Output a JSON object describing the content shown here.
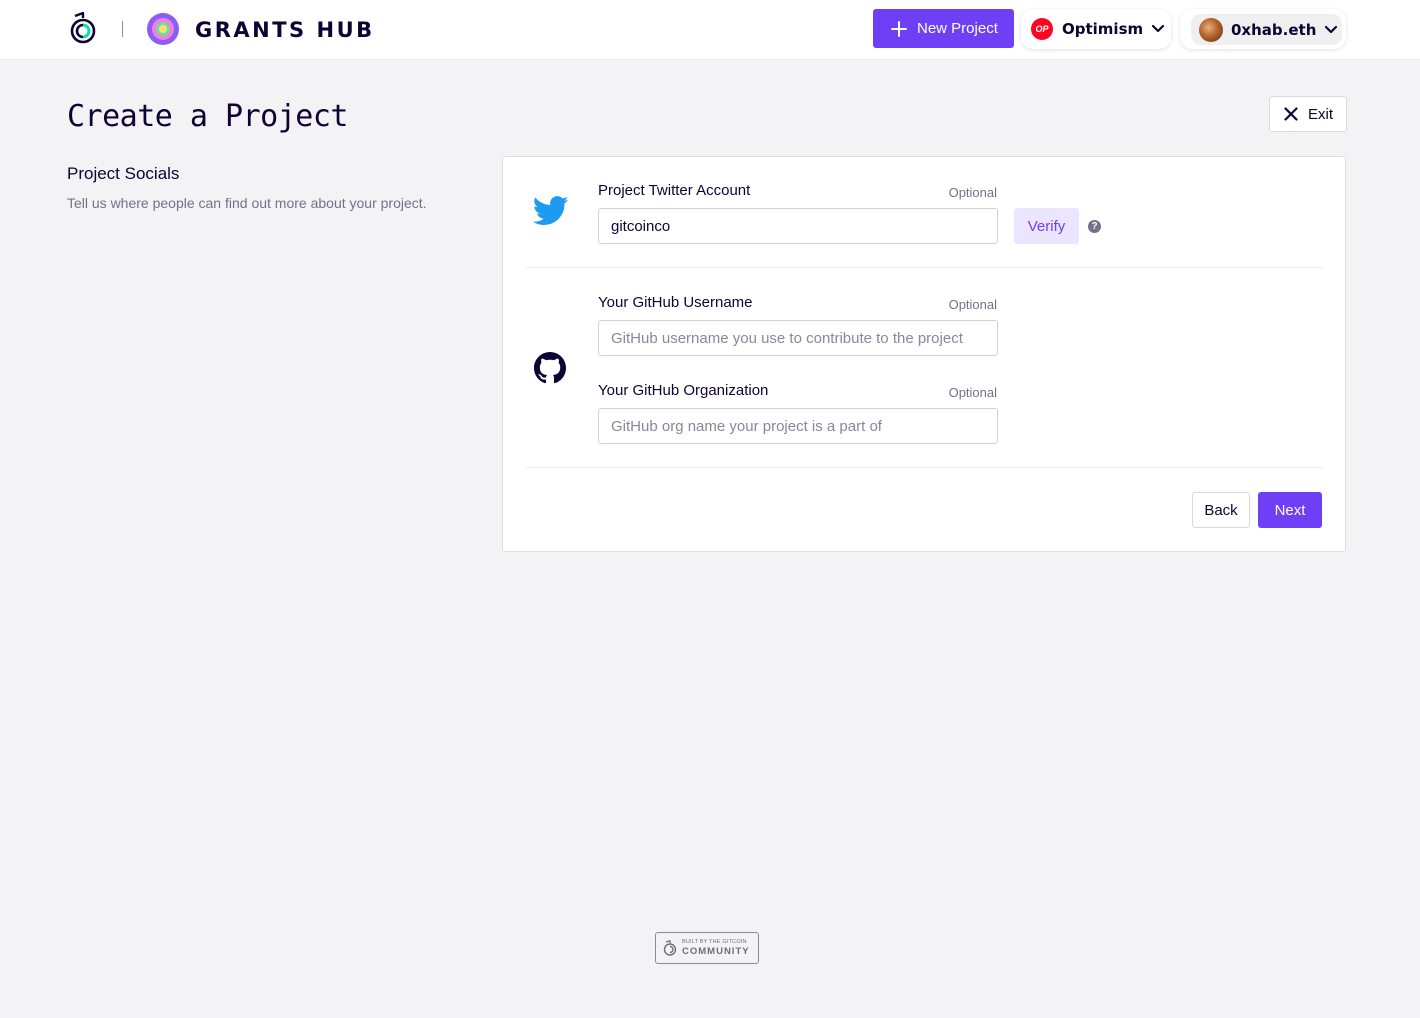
{
  "header": {
    "brand": "GRANTS HUB",
    "new_project_label": "New Project",
    "network": {
      "badge": "OP",
      "name": "Optimism"
    },
    "account": {
      "name": "0xhab.eth"
    }
  },
  "page": {
    "title": "Create a Project",
    "exit_label": "Exit"
  },
  "section": {
    "title": "Project Socials",
    "description": "Tell us where people can find out more about your project."
  },
  "form": {
    "twitter": {
      "label": "Project Twitter Account",
      "optional": "Optional",
      "value": "gitcoinco",
      "verify_label": "Verify",
      "help": "?"
    },
    "github_user": {
      "label": "Your GitHub Username",
      "optional": "Optional",
      "placeholder": "GitHub username you use to contribute to the project",
      "value": ""
    },
    "github_org": {
      "label": "Your GitHub Organization",
      "optional": "Optional",
      "placeholder": "GitHub org name your project is a part of",
      "value": ""
    },
    "back_label": "Back",
    "next_label": "Next"
  },
  "footer": {
    "small": "BUILT BY THE GITCOIN",
    "big": "COMMUNITY"
  },
  "colors": {
    "accent": "#6f3ff5",
    "twitter": "#1d9bf0",
    "op": "#ff0420",
    "background": "#f3f3f5"
  }
}
